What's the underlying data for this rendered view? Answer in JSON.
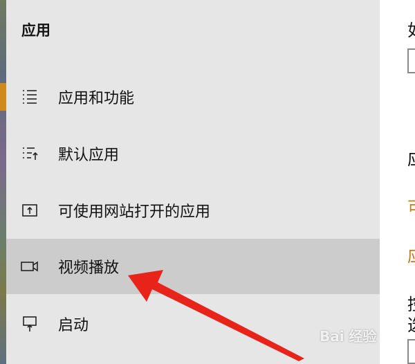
{
  "sidebar": {
    "title": "应用",
    "items": [
      {
        "label": "应用和功能",
        "icon": "apps-features-icon"
      },
      {
        "label": "默认应用",
        "icon": "default-apps-icon"
      },
      {
        "label": "可使用网站打开的应用",
        "icon": "apps-for-websites-icon"
      },
      {
        "label": "视频播放",
        "icon": "video-playback-icon",
        "selected": true
      },
      {
        "label": "启动",
        "icon": "startup-icon"
      }
    ]
  },
  "content": {
    "fragments": [
      "如",
      "应",
      "可",
      "应",
      "控",
      "选"
    ]
  },
  "watermark": {
    "text": "Bai 经验"
  },
  "colors": {
    "sidebar_bg": "#e6e6e6",
    "selected_bg": "#cccccc",
    "accent": "#d08a1c",
    "arrow": "#e8231a"
  }
}
